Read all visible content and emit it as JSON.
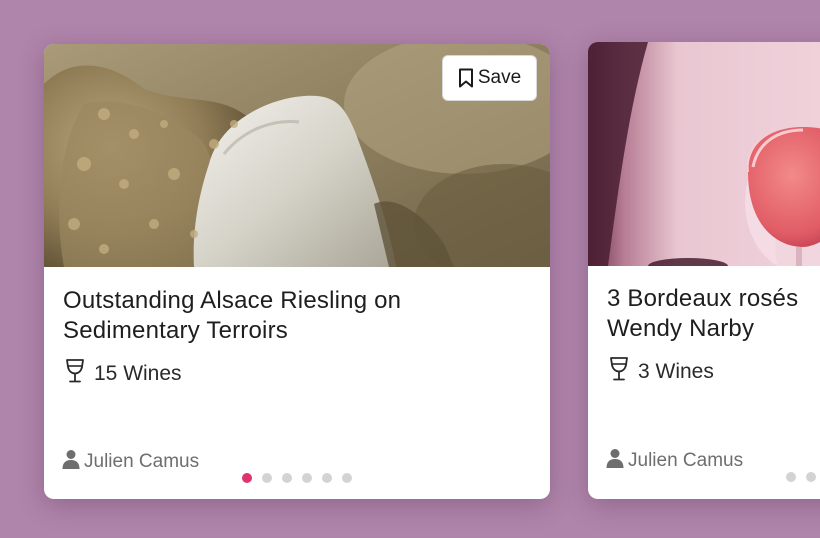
{
  "colors": {
    "background": "#b085ab",
    "card": "#ffffff",
    "dot_active": "#e0336b",
    "dot_inactive": "#d3d3d3"
  },
  "cards": [
    {
      "image": "sandy-limestone-rock-photo",
      "save_label": "Save",
      "save_icon": "bookmark-icon",
      "title": "Outstanding Alsace Riesling on Sedimentary Terroirs",
      "wine_icon": "wine-glass-icon",
      "wines_count": "15 Wines",
      "author_icon": "user-icon",
      "author": "Julien Camus",
      "dots_total": 6,
      "dots_active_index": 0
    },
    {
      "image": "rose-wine-glass-photo",
      "title": "3 Bordeaux rosés\nWendy Narby",
      "wine_icon": "wine-glass-icon",
      "wines_count": "3 Wines",
      "author_icon": "user-icon",
      "author": "Julien Camus"
    }
  ]
}
